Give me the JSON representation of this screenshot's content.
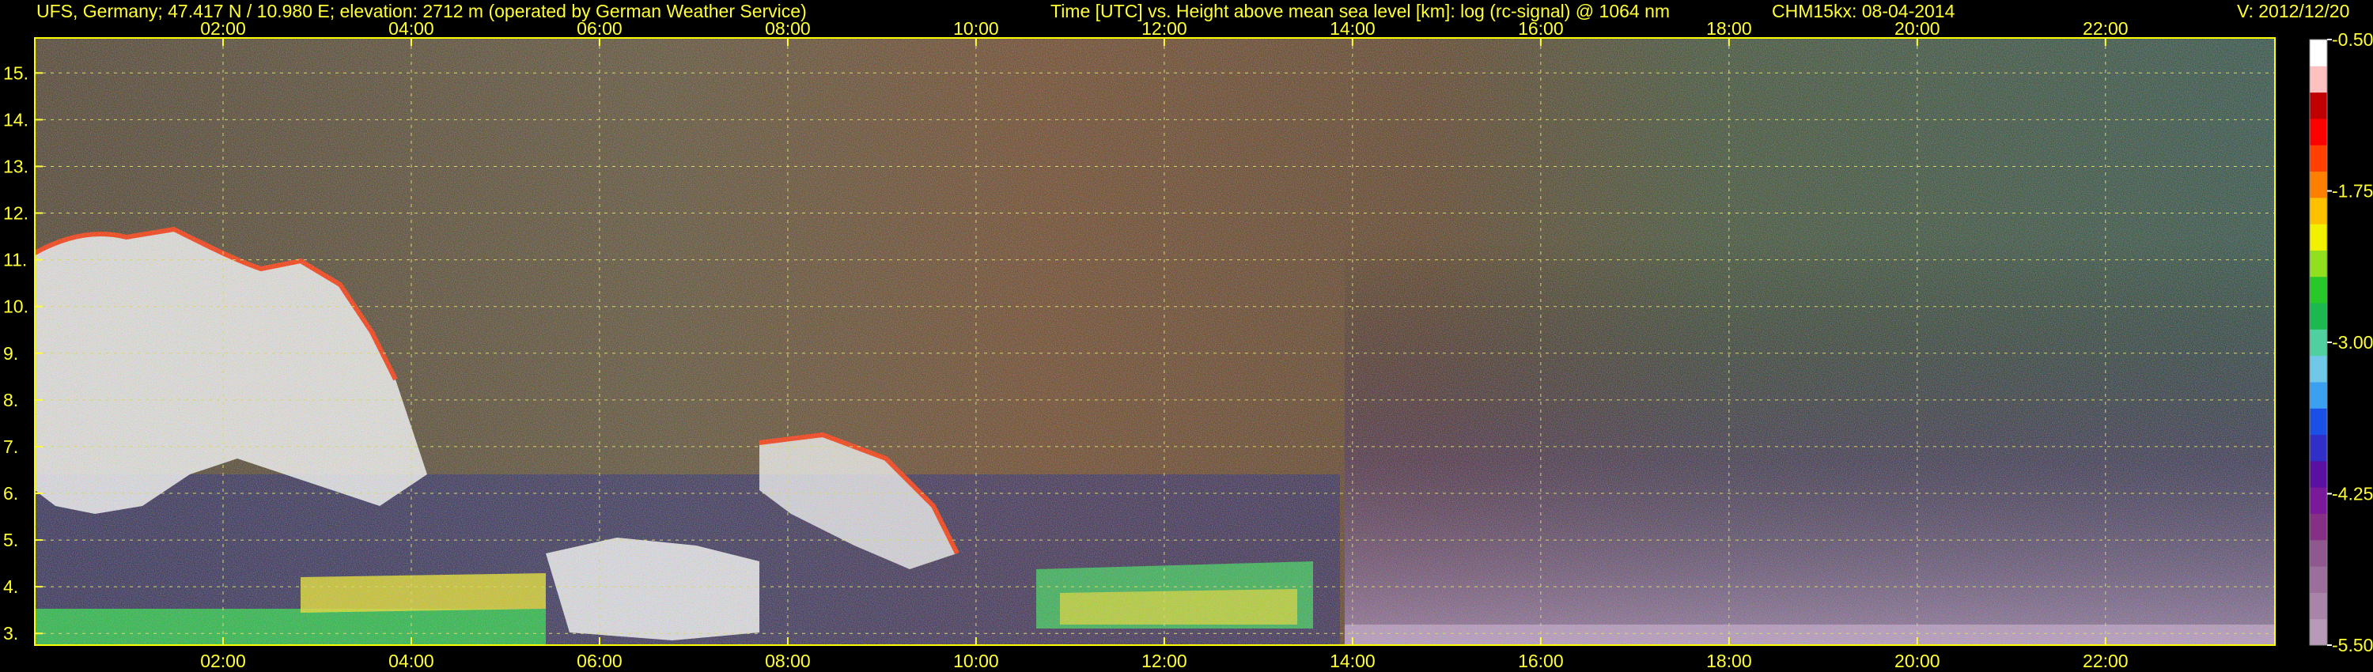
{
  "header": {
    "left": "UFS, Germany; 47.417 N / 10.980 E; elevation: 2712 m  (operated by German Weather Service)",
    "center": "Time [UTC] vs. Height above mean sea level [km]: log (rc-signal) @ 1064 nm",
    "instrument": "CHM15kx: 08-04-2014",
    "version": "V: 2012/12/20"
  },
  "colors": {
    "background": "#000000",
    "text": "#ffff33",
    "frame": "#ffff00",
    "grid": "#d8d870"
  },
  "chart_data": {
    "type": "heatmap",
    "title": "Time [UTC] vs. Height above mean sea level [km]: log (rc-signal) @ 1064 nm",
    "xlabel": "",
    "ylabel": "",
    "x_ticks": [
      "02:00",
      "04:00",
      "06:00",
      "08:00",
      "10:00",
      "12:00",
      "14:00",
      "16:00",
      "18:00",
      "20:00",
      "22:00"
    ],
    "x_tick_hours": [
      2,
      4,
      6,
      8,
      10,
      12,
      14,
      16,
      18,
      20,
      22
    ],
    "xlim_hours": [
      0,
      23.8
    ],
    "y_ticks": [
      3,
      4,
      5,
      6,
      7,
      8,
      9,
      10,
      11,
      12,
      13,
      14,
      15
    ],
    "y_tick_labels": [
      "3.",
      "4.",
      "5.",
      "6.",
      "7.",
      "8.",
      "9.",
      "10.",
      "11.",
      "12.",
      "13.",
      "14.",
      "15."
    ],
    "ylim_km": [
      2.75,
      15.75
    ],
    "grid": true,
    "colorbar": {
      "range": [
        -5.5,
        -0.5
      ],
      "ticks": [
        -0.5,
        -1.75,
        -3.0,
        -4.25,
        -5.5
      ],
      "tick_labels": [
        "-0.50",
        "-1.75",
        "-3.00",
        "-4.25",
        "-5.50"
      ],
      "colors": [
        "#b79ab7",
        "#a884a8",
        "#9b6e9b",
        "#8f588f",
        "#852f85",
        "#7a1a9a",
        "#5a10a0",
        "#3030c8",
        "#1a50e6",
        "#3ca0f0",
        "#70c8e8",
        "#50d0a0",
        "#1cb850",
        "#28c828",
        "#90e020",
        "#f0f000",
        "#ffc000",
        "#ff8000",
        "#ff4000",
        "#ff0000",
        "#c00000",
        "#ffc0c0",
        "#ffffff"
      ]
    }
  }
}
